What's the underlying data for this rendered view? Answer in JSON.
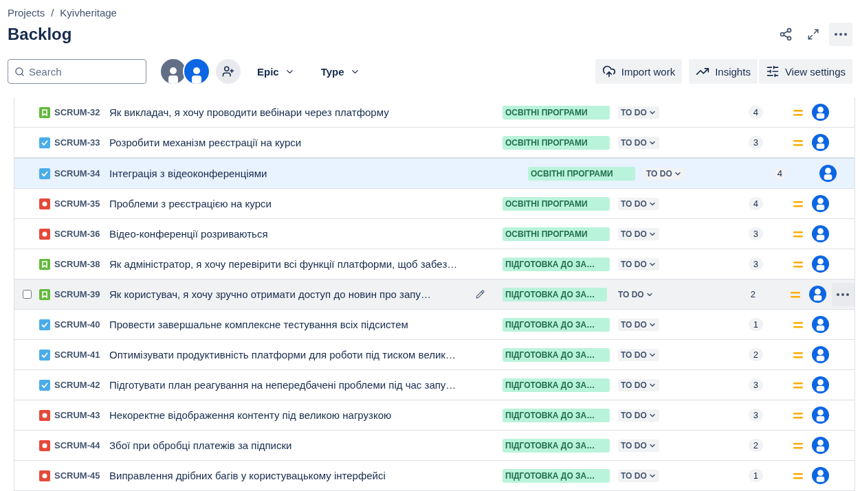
{
  "breadcrumbs": [
    "Projects",
    "/",
    "Kyivheritage"
  ],
  "title": "Backlog",
  "search": {
    "placeholder": "Search"
  },
  "filters": [
    {
      "label": "Epic"
    },
    {
      "label": "Type"
    }
  ],
  "toolbar_buttons": [
    {
      "kind": "import",
      "label": "Import work"
    },
    {
      "kind": "insights",
      "label": "Insights"
    },
    {
      "kind": "settings",
      "label": "View settings"
    }
  ],
  "rows": [
    {
      "kind": "story",
      "key": "SCRUM-32",
      "summary": "Як викладач, я хочу проводити вебінари через платформу",
      "epic": "ОСВІТНІ ПРОГРАМИ",
      "status": "TO DO",
      "points": "4",
      "dragging": false,
      "hovered": false
    },
    {
      "kind": "task",
      "key": "SCRUM-33",
      "summary": "Розробити механізм реєстрації на курси",
      "epic": "ОСВІТНІ ПРОГРАМИ",
      "status": "TO DO",
      "points": "3",
      "dragging": false,
      "hovered": false
    },
    {
      "kind": "task",
      "key": "SCRUM-34",
      "summary": "Інтеграція з відеоконференціями",
      "epic": "ОСВІТНІ ПРОГРАМИ",
      "status": "TO DO",
      "points": "4",
      "dragging": true,
      "hovered": false
    },
    {
      "kind": "bug",
      "key": "SCRUM-35",
      "summary": "Проблеми з реєстрацією на курси",
      "epic": "ОСВІТНІ ПРОГРАМИ",
      "status": "TO DO",
      "points": "4",
      "dragging": false,
      "hovered": false
    },
    {
      "kind": "bug",
      "key": "SCRUM-36",
      "summary": "Відео-конференції розриваються",
      "epic": "ОСВІТНІ ПРОГРАМИ",
      "status": "TO DO",
      "points": "3",
      "dragging": false,
      "hovered": false
    },
    {
      "kind": "story",
      "key": "SCRUM-38",
      "summary": "Як адміністратор, я хочу перевірити всі функції платформи, щоб забез…",
      "epic": "ПІДГОТОВКА ДО ЗА…",
      "status": "TO DO",
      "points": "3",
      "dragging": false,
      "hovered": false
    },
    {
      "kind": "story",
      "key": "SCRUM-39",
      "summary": "Як користувач, я хочу зручно отримати доступ до новин про запу…",
      "epic": "ПІДГОТОВКА ДО ЗА…",
      "status": "TO DO",
      "points": "2",
      "dragging": false,
      "hovered": true
    },
    {
      "kind": "task",
      "key": "SCRUM-40",
      "summary": "Провести завершальне комплексне тестування всіх підсистем",
      "epic": "ПІДГОТОВКА ДО ЗА…",
      "status": "TO DO",
      "points": "1",
      "dragging": false,
      "hovered": false
    },
    {
      "kind": "task",
      "key": "SCRUM-41",
      "summary": "Оптимізувати продуктивність платформи для роботи під тиском велик…",
      "epic": "ПІДГОТОВКА ДО ЗА…",
      "status": "TO DO",
      "points": "2",
      "dragging": false,
      "hovered": false
    },
    {
      "kind": "task",
      "key": "SCRUM-42",
      "summary": "Підготувати план реагування на непередбачені проблеми під час запу…",
      "epic": "ПІДГОТОВКА ДО ЗА…",
      "status": "TO DO",
      "points": "3",
      "dragging": false,
      "hovered": false
    },
    {
      "kind": "bug",
      "key": "SCRUM-43",
      "summary": "Некоректне відображення контенту під великою нагрузкою",
      "epic": "ПІДГОТОВКА ДО ЗА…",
      "status": "TO DO",
      "points": "3",
      "dragging": false,
      "hovered": false
    },
    {
      "kind": "bug",
      "key": "SCRUM-44",
      "summary": "Збої при обробці платежів за підписки",
      "epic": "ПІДГОТОВКА ДО ЗА…",
      "status": "TO DO",
      "points": "2",
      "dragging": false,
      "hovered": false
    },
    {
      "kind": "bug",
      "key": "SCRUM-45",
      "summary": "Виправлення дрібних багів у користувацькому інтерфейсі",
      "epic": "ПІДГОТОВКА ДО ЗА…",
      "status": "TO DO",
      "points": "1",
      "dragging": false,
      "hovered": false
    }
  ]
}
